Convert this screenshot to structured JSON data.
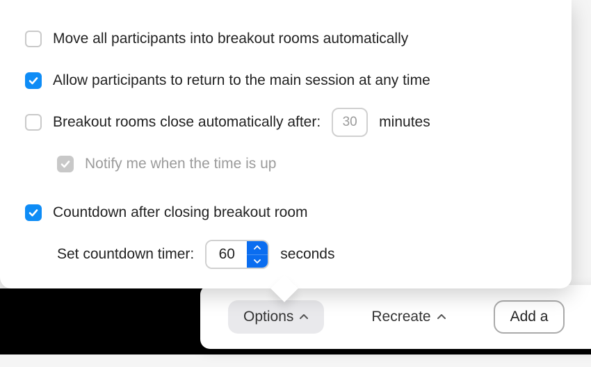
{
  "options": {
    "move_automatically": {
      "label": "Move all participants into breakout rooms automatically",
      "checked": false
    },
    "allow_return": {
      "label": "Allow participants to return to the main session at any time",
      "checked": true
    },
    "auto_close": {
      "label": "Breakout rooms close automatically after:",
      "checked": false,
      "minutes_value": "30",
      "minutes_unit": "minutes"
    },
    "notify_time_up": {
      "label": "Notify me when the time is up",
      "checked": true,
      "disabled": true
    },
    "countdown": {
      "label": "Countdown after closing breakout room",
      "checked": true,
      "timer_label": "Set countdown timer:",
      "timer_value": "60",
      "timer_unit": "seconds"
    }
  },
  "toolbar": {
    "options_label": "Options",
    "recreate_label": "Recreate",
    "add_label": "Add a "
  }
}
